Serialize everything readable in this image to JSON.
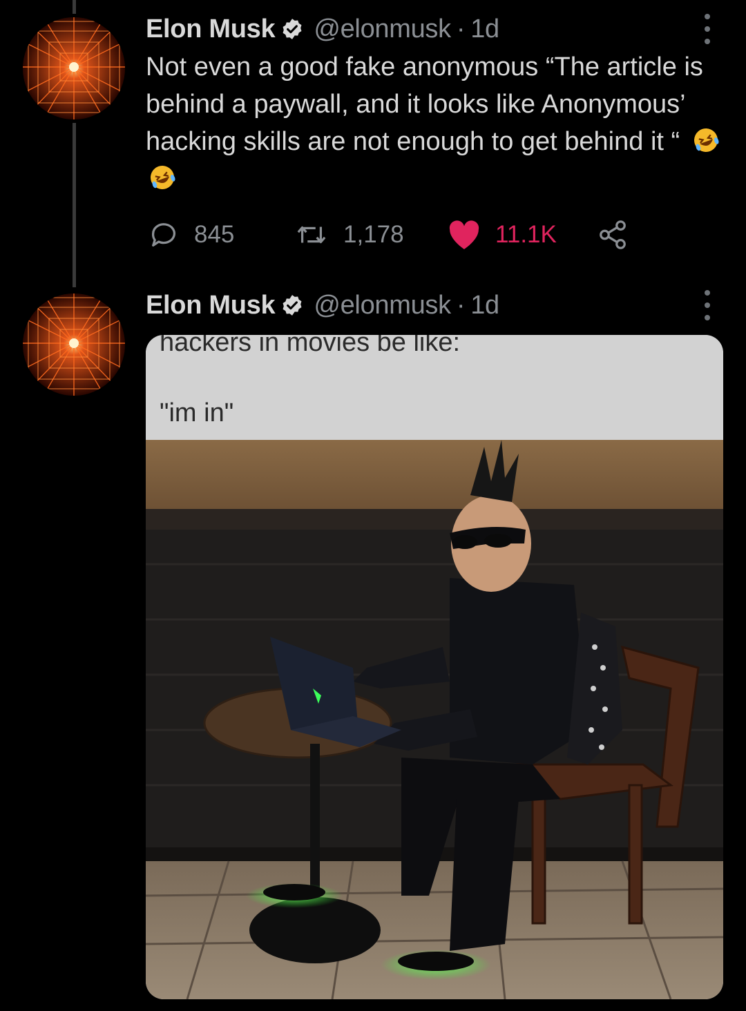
{
  "tweets": [
    {
      "author_name": "Elon Musk",
      "handle": "@elonmusk",
      "separator": "·",
      "time": "1d",
      "text": "Not even a good fake anonymous “The article is behind a paywall, and it looks like Anonymous’ hacking skills are not enough to get behind it “",
      "emoji": [
        "rolling-on-floor-laughing",
        "rolling-on-floor-laughing"
      ],
      "stats": {
        "replies": "845",
        "retweets": "1,178",
        "likes": "11.1K"
      },
      "liked": true
    },
    {
      "author_name": "Elon Musk",
      "handle": "@elonmusk",
      "separator": "·",
      "time": "1d",
      "media": {
        "caption_line1": "hackers in movies be like:",
        "caption_line2": "\"im in\""
      }
    }
  ],
  "colors": {
    "background": "#000000",
    "text": "#d9d9d9",
    "muted": "#8b8f94",
    "like": "#e0245e",
    "thread_line": "#3a3a3a"
  },
  "icons": [
    "avatar-laser-tunnel",
    "verified-badge-icon",
    "more-options-icon",
    "reply-icon",
    "retweet-icon",
    "heart-icon",
    "share-icon"
  ]
}
